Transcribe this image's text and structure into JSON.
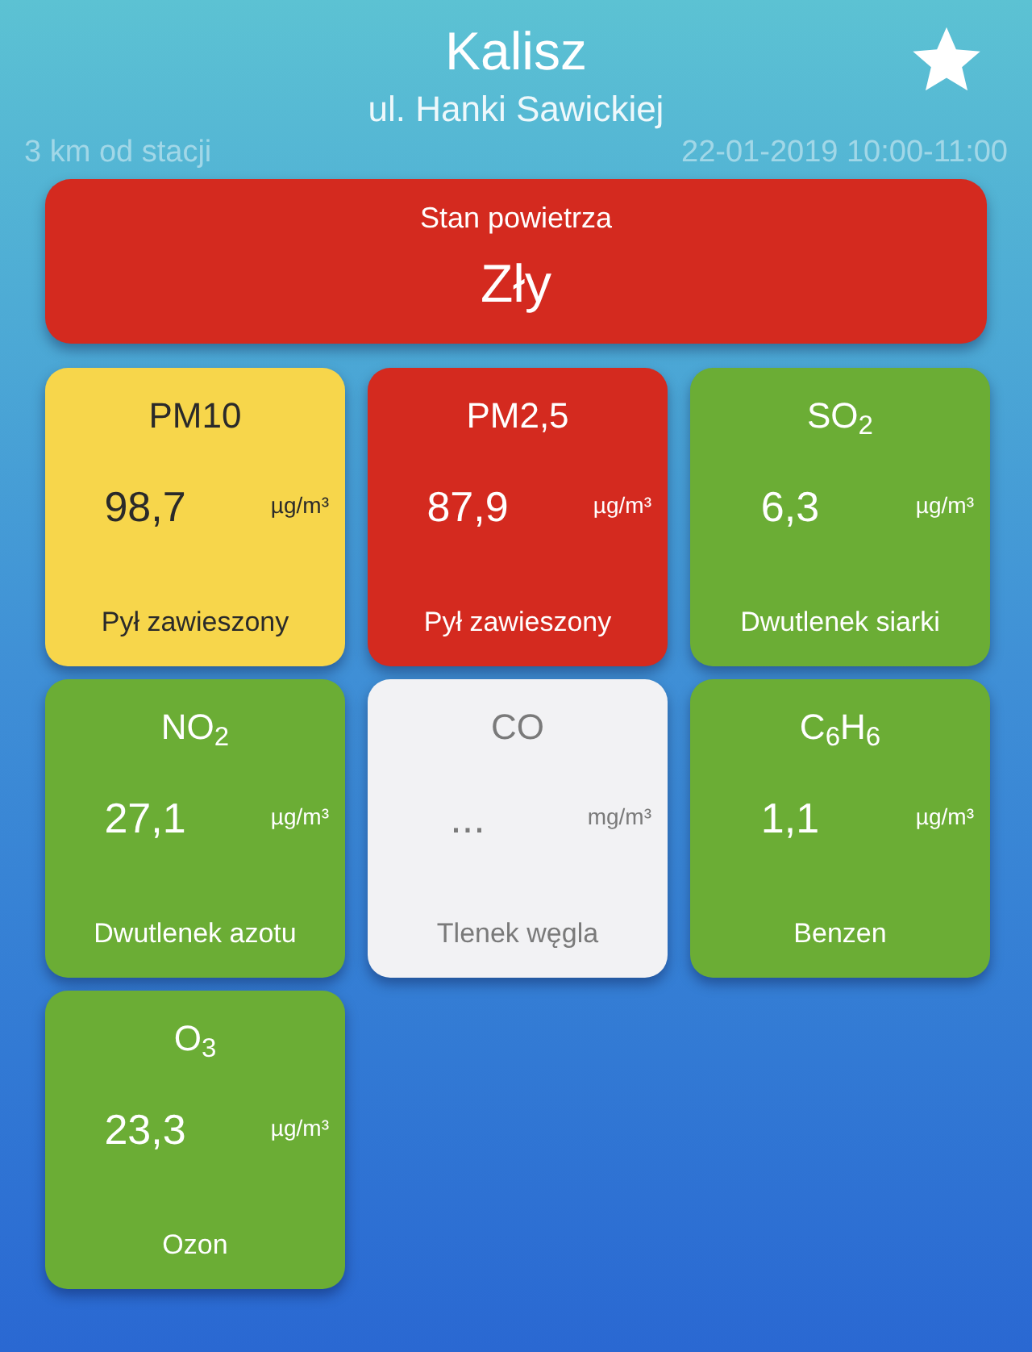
{
  "header": {
    "city": "Kalisz",
    "street": "ul. Hanki Sawickiej",
    "distance": "3 km od stacji",
    "time_range": "22-01-2019 10:00-11:00",
    "favorite": true
  },
  "air_quality": {
    "label": "Stan powietrza",
    "value": "Zły",
    "color": "#d42a1f"
  },
  "tiles": [
    {
      "name": "PM10",
      "value": "98,7",
      "unit": "µg/m³",
      "description": "Pył zawieszony",
      "color": "#f7d64b"
    },
    {
      "name": "PM2,5",
      "value": "87,9",
      "unit": "µg/m³",
      "description": "Pył zawieszony",
      "color": "#d42a1f"
    },
    {
      "name": "SO$_{2}$",
      "value": "6,3",
      "unit": "µg/m³",
      "description": "Dwutlenek siarki",
      "color": "#6bad35"
    },
    {
      "name": "NO$_{2}$",
      "value": "27,1",
      "unit": "µg/m³",
      "description": "Dwutlenek azotu",
      "color": "#6bad35"
    },
    {
      "name": "CO",
      "value": "...",
      "unit": "mg/m³",
      "description": "Tlenek węgla",
      "color": "#f2f2f4"
    },
    {
      "name": "C$_{6}$H$_{6}$",
      "value": "1,1",
      "unit": "µg/m³",
      "description": "Benzen",
      "color": "#6bad35"
    },
    {
      "name": "O$_{3}$",
      "value": "23,3",
      "unit": "µg/m³",
      "description": "Ozon",
      "color": "#6bad35"
    }
  ]
}
